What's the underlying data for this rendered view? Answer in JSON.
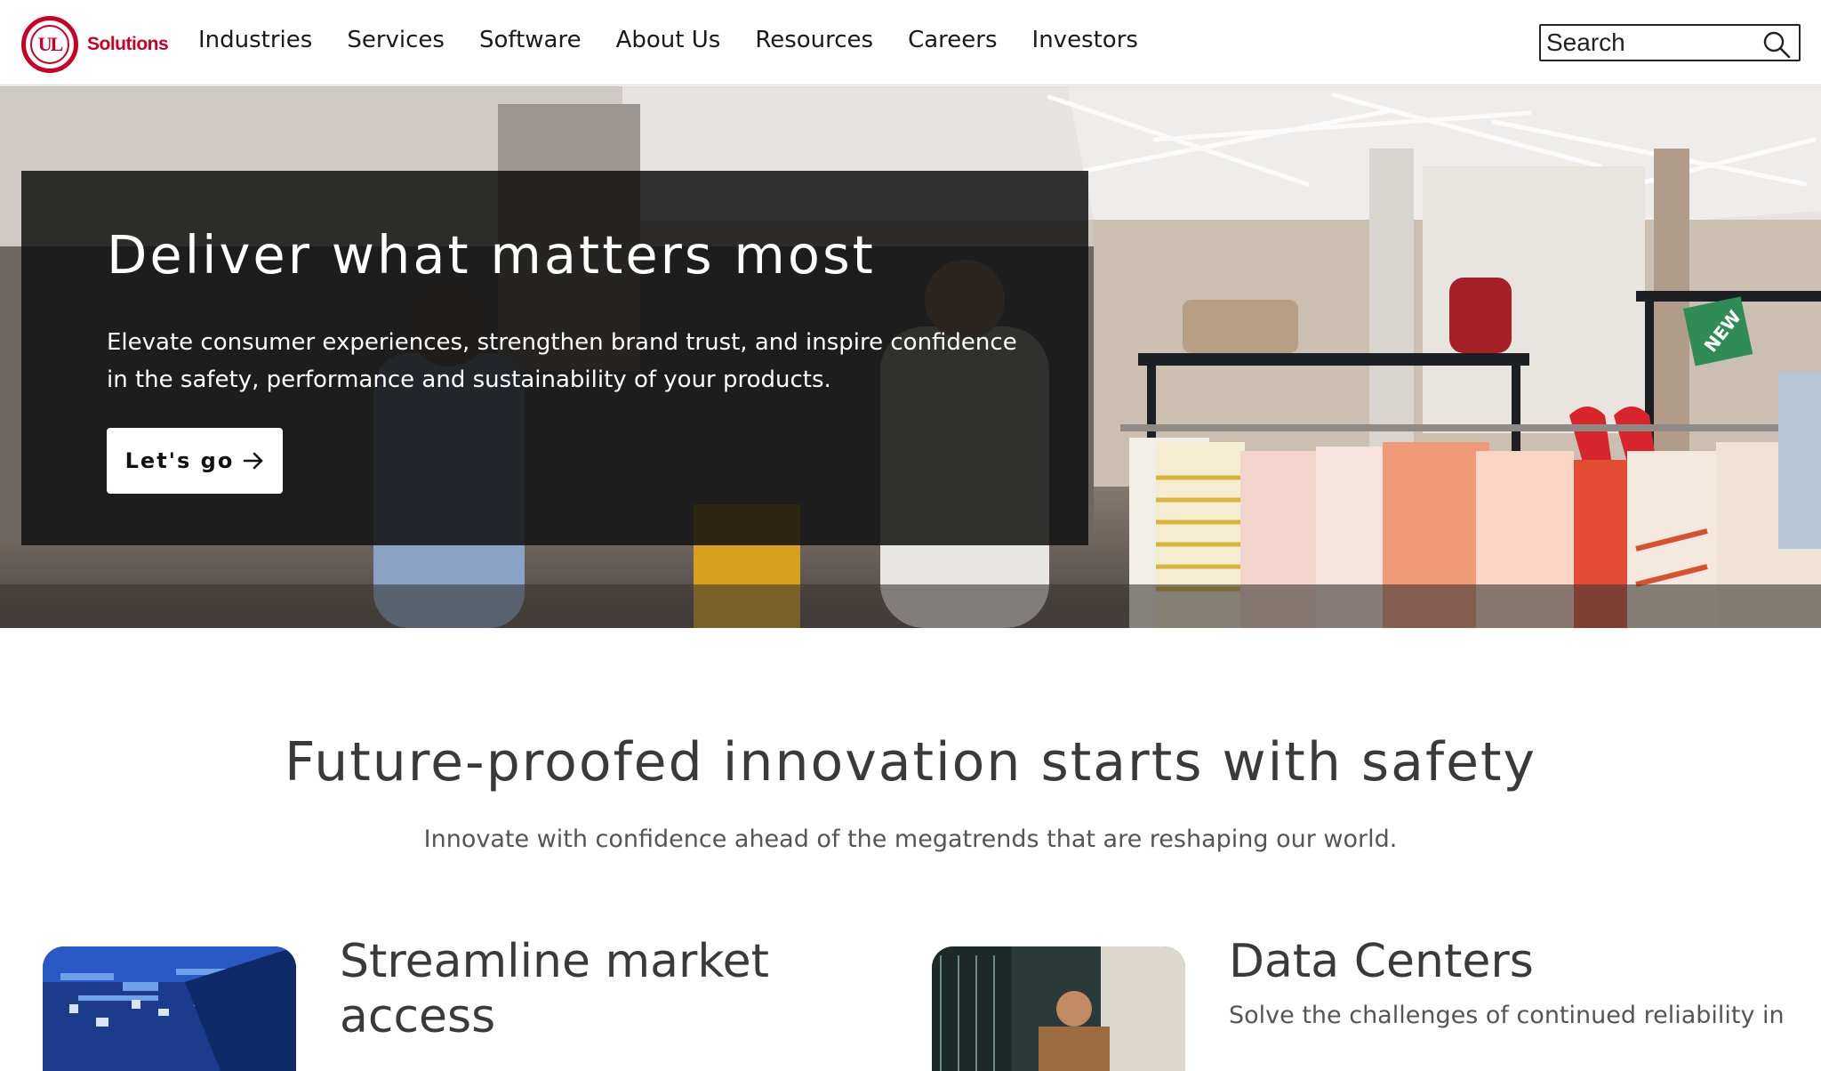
{
  "header": {
    "logo_mark": "UL",
    "logo_word": "Solutions",
    "nav": [
      "Industries",
      "Services",
      "Software",
      "About Us",
      "Resources",
      "Careers",
      "Investors"
    ],
    "search_placeholder": "Search"
  },
  "hero": {
    "title": "Deliver what matters most",
    "subtitle_line1": "Elevate consumer experiences, strengthen brand trust, and inspire confidence",
    "subtitle_line2": "in the safety, performance and sustainability of your products.",
    "cta_label": "Let's go",
    "sign_text": "NEW"
  },
  "section": {
    "title": "Future-proofed innovation starts with safety",
    "subtitle": "Innovate with confidence ahead of the megatrends that are reshaping our world."
  },
  "cards": [
    {
      "title_line1": "Streamline market",
      "title_line2": "access"
    },
    {
      "title": "Data Centers",
      "text": "Solve the challenges of continued reliability in"
    }
  ],
  "colors": {
    "brand_red": "#ca0123",
    "panel_dark": "#121212"
  },
  "icons": {
    "search": "search-icon",
    "arrow": "arrow-right-icon"
  }
}
